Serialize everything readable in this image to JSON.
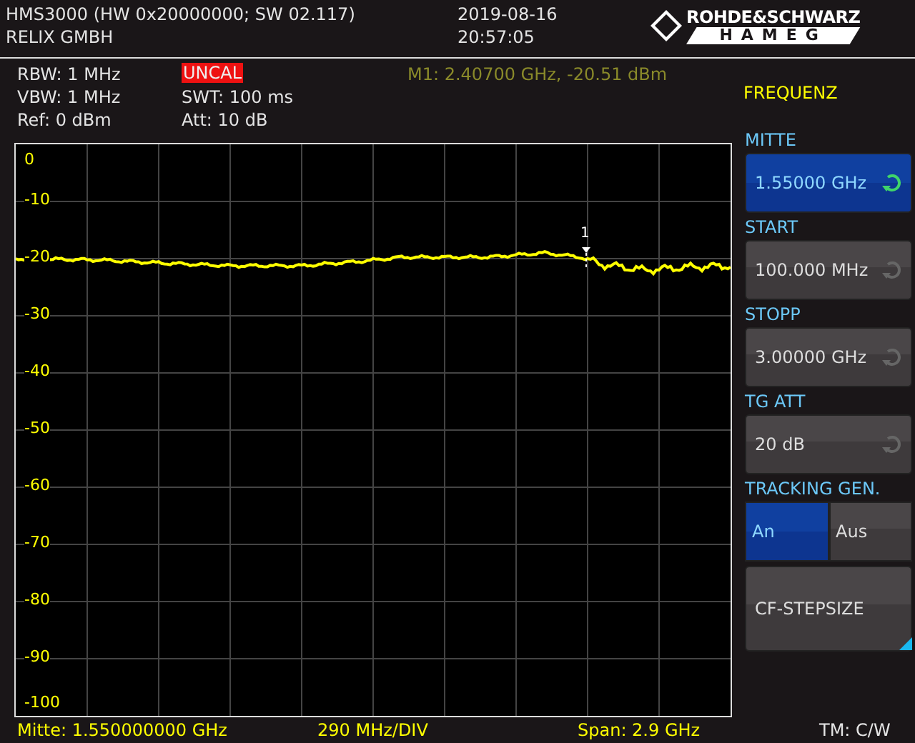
{
  "header": {
    "device": "HMS3000 (HW 0x20000000; SW 02.117)",
    "company": "RELIX GMBH",
    "date": "2019-08-16",
    "time": "20:57:05",
    "logo_top": "ROHDE&SCHWARZ",
    "logo_bottom": "HAMEG"
  },
  "settings": {
    "rbw": "RBW: 1 MHz",
    "vbw": "VBW: 1 MHz",
    "ref": "Ref: 0 dBm",
    "uncal": "UNCAL",
    "swt": "SWT: 100 ms",
    "att": "Att: 10 dB"
  },
  "marker_readout": "M1: 2.40700 GHz, -20.51 dBm",
  "menu_title": "FREQUENZ",
  "softkeys": [
    {
      "kind": "value",
      "label": "MITTE",
      "value": "1.55000 GHz",
      "selected": true
    },
    {
      "kind": "value",
      "label": "START",
      "value": "100.000 MHz",
      "selected": false
    },
    {
      "kind": "value",
      "label": "STOPP",
      "value": "3.00000 GHz",
      "selected": false
    },
    {
      "kind": "value",
      "label": "TG ATT",
      "value": "20 dB",
      "selected": false
    },
    {
      "kind": "toggle",
      "label": "TRACKING GEN.",
      "options": [
        {
          "label": "An",
          "selected": true
        },
        {
          "label": "Aus",
          "selected": false
        }
      ]
    },
    {
      "kind": "action",
      "value": "CF-STEPSIZE"
    }
  ],
  "plot": {
    "y_labels": [
      "0",
      "-10",
      "-20",
      "-30",
      "-40",
      "-50",
      "-60",
      "-70",
      "-80",
      "-90",
      "-100"
    ],
    "marker_label": "1"
  },
  "status": {
    "center": "Mitte: 1.550000000 GHz",
    "div": "290 MHz/DIV",
    "span": "Span: 2.9 GHz",
    "mode": "TM: C/W"
  }
}
